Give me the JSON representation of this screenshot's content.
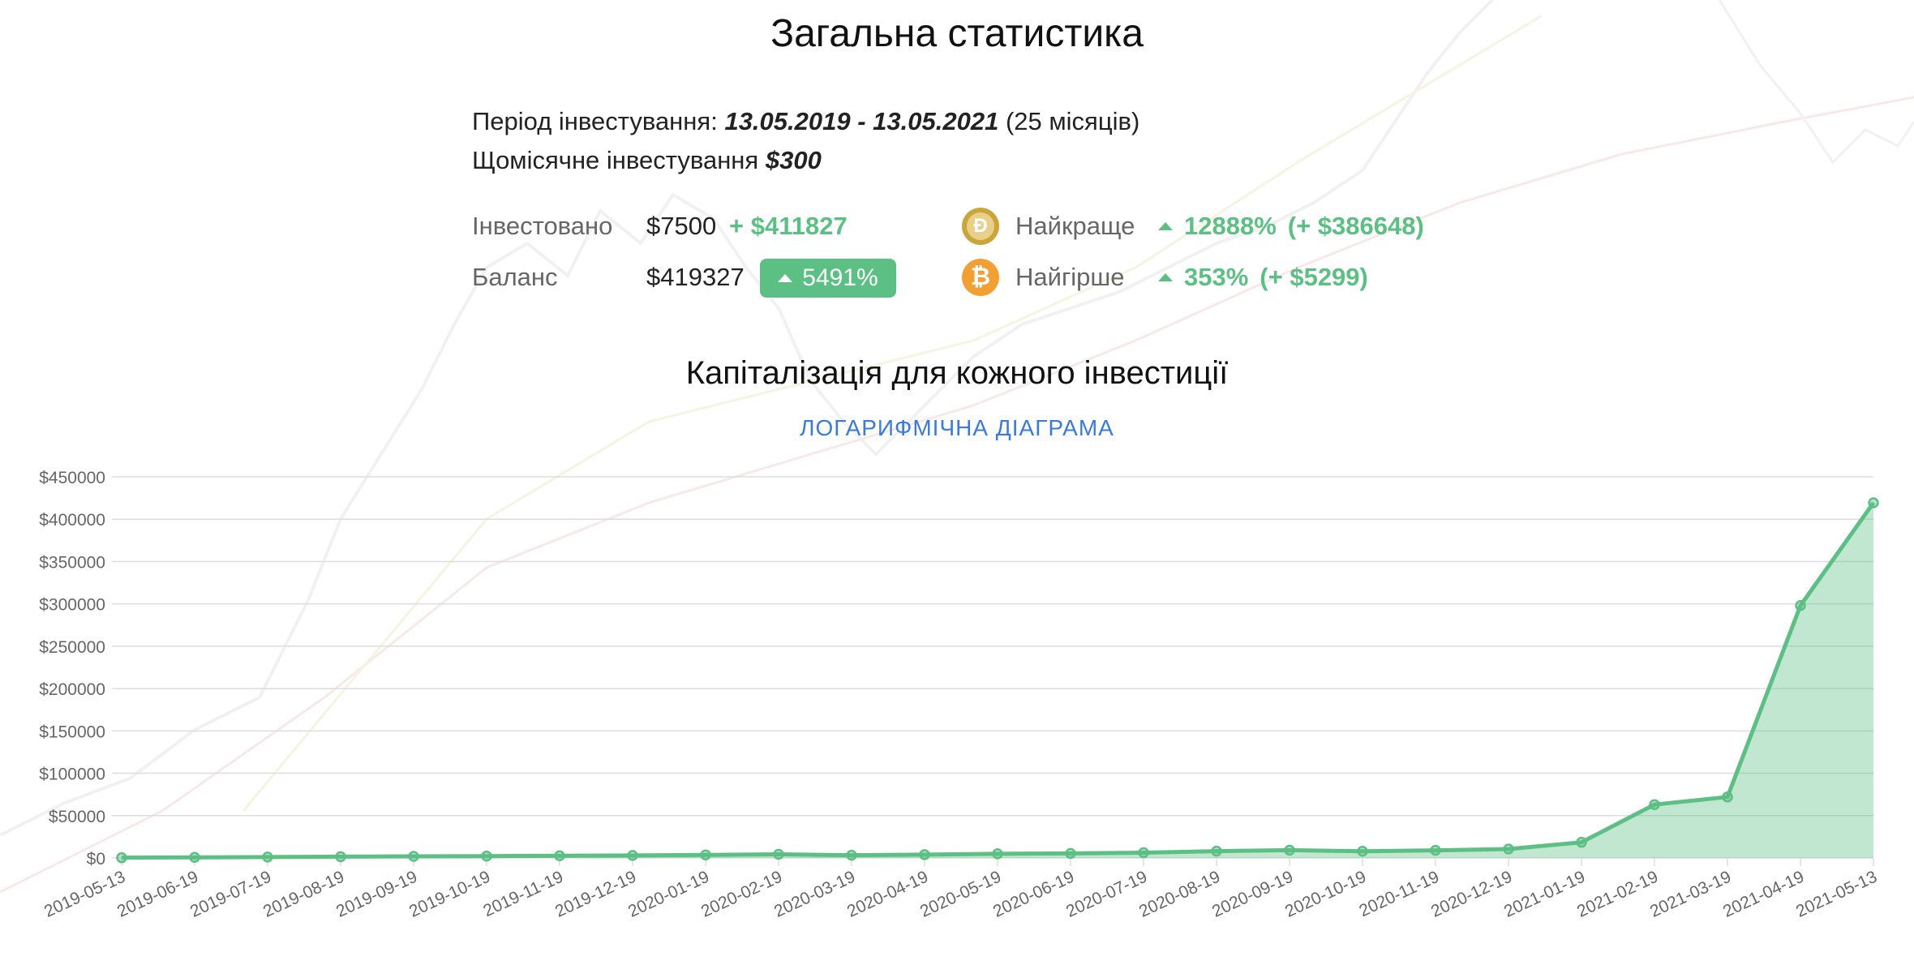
{
  "header": {
    "title": "Загальна статистика"
  },
  "period": {
    "label": "Період інвестування:",
    "range": "13.05.2019 - 13.05.2021",
    "months": "(25 місяців)"
  },
  "monthly": {
    "label": "Щомісячне інвестування",
    "amount": "$300"
  },
  "stats": {
    "invested_label": "Інвестовано",
    "invested_value": "$7500",
    "invested_gain": "+ $411827",
    "balance_label": "Баланс",
    "balance_value": "$419327",
    "balance_pct": "5491%"
  },
  "best": {
    "label": "Найкраще",
    "pct": "12888%",
    "gain": "(+ $386648)",
    "icon": "dogecoin-icon",
    "color": "#c9a53a"
  },
  "worst": {
    "label": "Найгірше",
    "pct": "353%",
    "gain": "(+ $5299)",
    "icon": "bitcoin-icon",
    "color": "#f2a033"
  },
  "chart_section": {
    "title": "Капіталізація для кожного інвестиції",
    "log_link": "ЛОГАРИФМІЧНА ДІАГРАМА"
  },
  "colors": {
    "accent_green": "#5cbf84",
    "link_blue": "#3a7bd5"
  },
  "chart_data": {
    "type": "area",
    "title": "Капіталізація для кожного інвестиції",
    "xlabel": "",
    "ylabel": "",
    "ylim": [
      0,
      450000
    ],
    "yticks": [
      "$0",
      "$50000",
      "$100000",
      "$150000",
      "$200000",
      "$250000",
      "$300000",
      "$350000",
      "$400000",
      "$450000"
    ],
    "grid": true,
    "x": [
      "2019-05-13",
      "2019-06-19",
      "2019-07-19",
      "2019-08-19",
      "2019-09-19",
      "2019-10-19",
      "2019-11-19",
      "2019-12-19",
      "2020-01-19",
      "2020-02-19",
      "2020-03-19",
      "2020-04-19",
      "2020-05-19",
      "2020-06-19",
      "2020-07-19",
      "2020-08-19",
      "2020-09-19",
      "2020-10-19",
      "2020-11-19",
      "2020-12-19",
      "2021-01-19",
      "2021-02-19",
      "2021-03-19",
      "2021-04-19",
      "2021-05-13"
    ],
    "series": [
      {
        "values": [
          300,
          700,
          1100,
          1500,
          1900,
          2200,
          2600,
          3000,
          3600,
          4300,
          3200,
          3900,
          4900,
          5400,
          6200,
          8000,
          9200,
          7900,
          9000,
          10500,
          18500,
          63000,
          72000,
          298000,
          419327
        ]
      }
    ]
  }
}
